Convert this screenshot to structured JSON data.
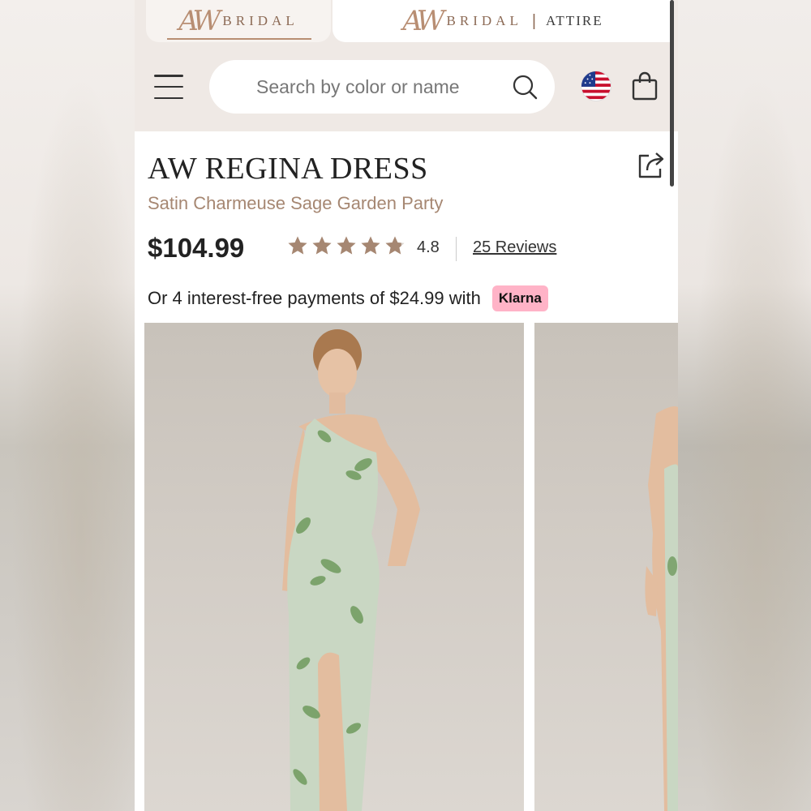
{
  "brands": {
    "primary": {
      "mark": "AW",
      "name": "BRIDAL"
    },
    "secondary": {
      "mark": "AW",
      "name": "BRIDAL",
      "sub": "ATTIRE"
    }
  },
  "search": {
    "placeholder": "Search by color or name"
  },
  "icons": [
    "menu-icon",
    "search-icon",
    "us-flag-icon",
    "shopping-bag-icon",
    "share-icon",
    "star-icon"
  ],
  "product": {
    "title": "AW REGINA DRESS",
    "subtitle": "Satin Charmeuse Sage Garden Party",
    "price": "$104.99",
    "rating": 4.8,
    "rating_text": "4.8",
    "reviews": "25 Reviews",
    "installment_text": "Or 4 interest-free payments of $24.99 with",
    "klarna_label": "Klarna"
  },
  "colors": {
    "accent": "#b88e73",
    "subtitle": "#a68772",
    "klarna": "#ffb3c7",
    "dress": "#c9d7c3",
    "leaf": "#6f9a5e"
  }
}
